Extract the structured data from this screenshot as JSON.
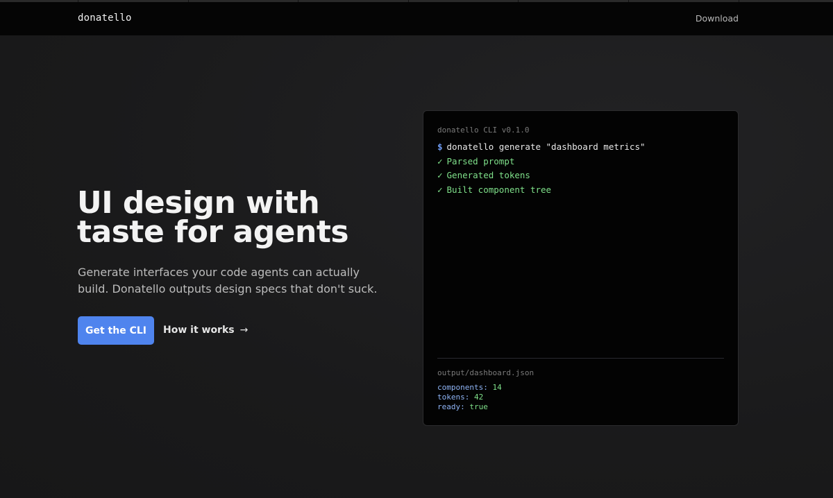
{
  "nav": {
    "logo": "donatello",
    "download": "Download"
  },
  "hero": {
    "title_lines": [
      "UI design with",
      "taste for agents"
    ],
    "subtitle_lines": [
      "Generate interfaces your code agents can actually",
      "build. Donatello outputs design specs that don't suck."
    ],
    "primary_cta": "Get the CLI",
    "secondary_cta": "How it works",
    "secondary_icon": "arrow-right-icon"
  },
  "terminal": {
    "title": "donatello CLI v0.1.0",
    "prompt_symbol": "$",
    "command": "donatello generate \"dashboard metrics\"",
    "check_symbol": "✓",
    "steps": [
      "Parsed prompt",
      "Generated tokens",
      "Built component tree"
    ],
    "output_file": "output/dashboard.json",
    "output": [
      {
        "key": "components:",
        "value": "14"
      },
      {
        "key": "tokens:",
        "value": "42"
      },
      {
        "key": "ready:",
        "value": "true"
      }
    ]
  },
  "colors": {
    "accent": "#4f84ee",
    "success": "#7fe08a",
    "key": "#8fb4f5"
  }
}
